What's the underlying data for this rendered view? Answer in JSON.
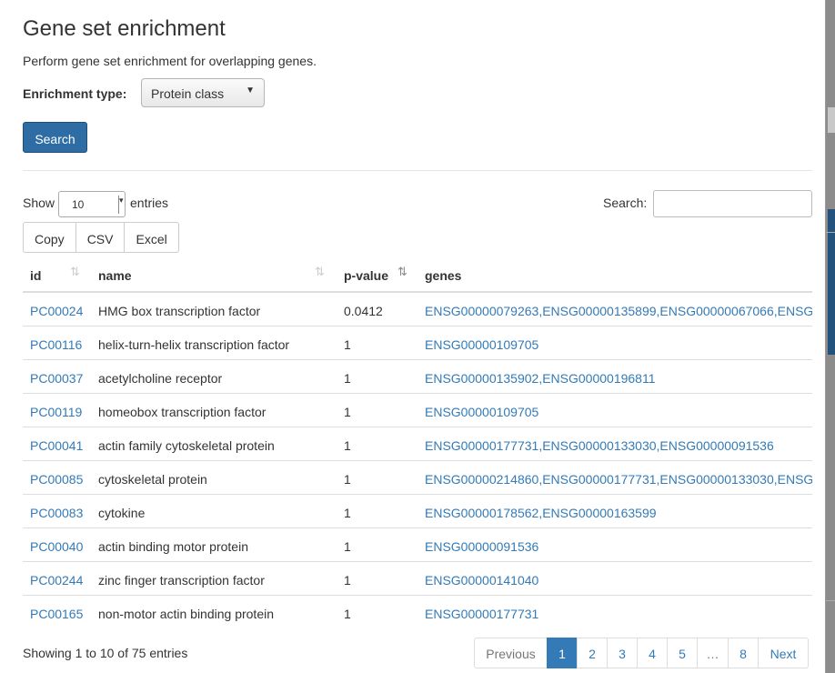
{
  "modal": {
    "title": "Gene set enrichment",
    "subtitle": "Perform gene set enrichment for overlapping genes.",
    "enrichment_label": "Enrichment type:",
    "enrichment_value": "Protein class",
    "search_button": "Search"
  },
  "table_controls": {
    "show_label": "Show",
    "page_length": "10",
    "entries_label": "entries",
    "search_label": "Search:",
    "search_value": "",
    "export_buttons": [
      "Copy",
      "CSV",
      "Excel"
    ]
  },
  "table": {
    "columns": [
      "id",
      "name",
      "p-value",
      "genes"
    ],
    "rows": [
      {
        "id": "PC00024",
        "name": "HMG box transcription factor",
        "pvalue": "0.0412",
        "genes": "ENSG00000079263,ENSG00000135899,ENSG00000067066,ENSG"
      },
      {
        "id": "PC00116",
        "name": "helix-turn-helix transcription factor",
        "pvalue": "1",
        "genes": "ENSG00000109705"
      },
      {
        "id": "PC00037",
        "name": "acetylcholine receptor",
        "pvalue": "1",
        "genes": "ENSG00000135902,ENSG00000196811"
      },
      {
        "id": "PC00119",
        "name": "homeobox transcription factor",
        "pvalue": "1",
        "genes": "ENSG00000109705"
      },
      {
        "id": "PC00041",
        "name": "actin family cytoskeletal protein",
        "pvalue": "1",
        "genes": "ENSG00000177731,ENSG00000133030,ENSG00000091536"
      },
      {
        "id": "PC00085",
        "name": "cytoskeletal protein",
        "pvalue": "1",
        "genes": "ENSG00000214860,ENSG00000177731,ENSG00000133030,ENSG"
      },
      {
        "id": "PC00083",
        "name": "cytokine",
        "pvalue": "1",
        "genes": "ENSG00000178562,ENSG00000163599"
      },
      {
        "id": "PC00040",
        "name": "actin binding motor protein",
        "pvalue": "1",
        "genes": "ENSG00000091536"
      },
      {
        "id": "PC00244",
        "name": "zinc finger transcription factor",
        "pvalue": "1",
        "genes": "ENSG00000141040"
      },
      {
        "id": "PC00165",
        "name": "non-motor actin binding protein",
        "pvalue": "1",
        "genes": "ENSG00000177731"
      }
    ]
  },
  "footer": {
    "info": "Showing 1 to 10 of 75 entries",
    "pagination": {
      "previous": "Previous",
      "pages": [
        "1",
        "2",
        "3",
        "4",
        "5",
        "…",
        "8"
      ],
      "current": "1",
      "next": "Next"
    }
  },
  "icons": {
    "sort_unsorted": "sort-both-icon",
    "sort_active": "sort-ascending-icon",
    "select_arrow": "chevron-down-icon"
  },
  "colors": {
    "link": "#337ab7",
    "primary_button": "#2e6da4",
    "current_page": "#337ab7"
  }
}
